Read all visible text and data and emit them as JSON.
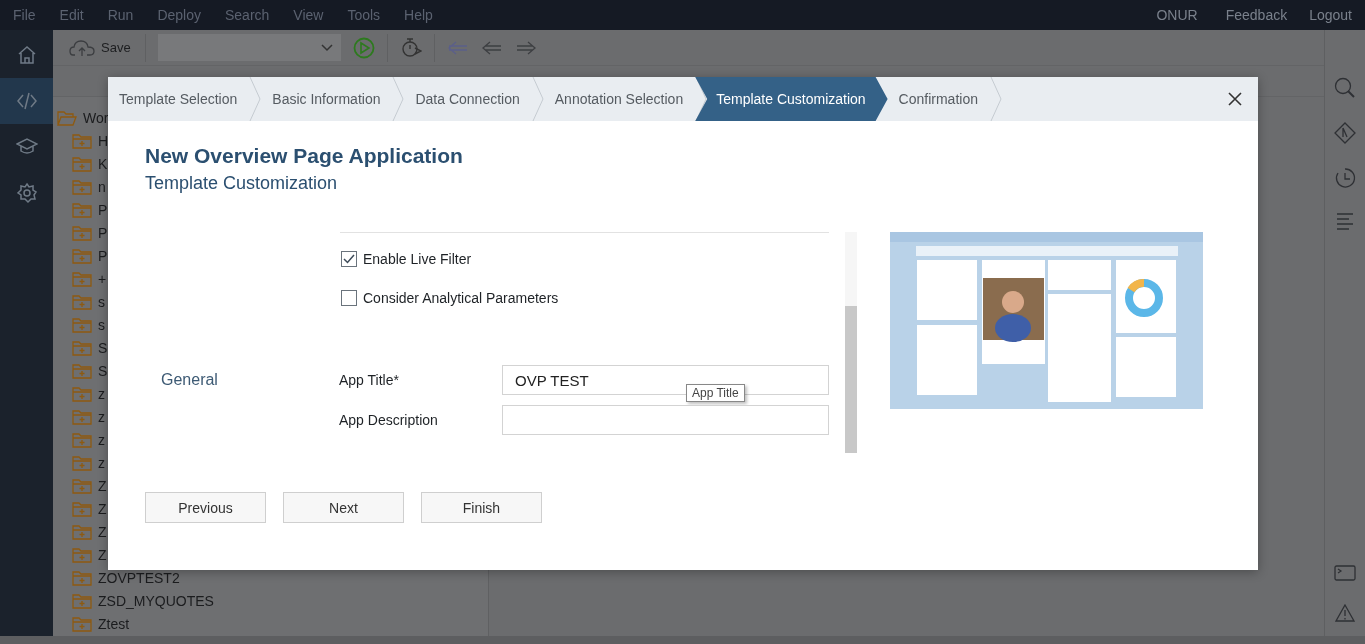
{
  "menu_bar": {
    "items": [
      "File",
      "Edit",
      "Run",
      "Deploy",
      "Search",
      "View",
      "Tools",
      "Help"
    ],
    "user": "ONUR",
    "links": [
      "Feedback",
      "Logout"
    ]
  },
  "rail": {
    "items": [
      {
        "kind": "home",
        "selected": false
      },
      {
        "kind": "code",
        "selected": true
      },
      {
        "kind": "learn",
        "selected": false
      },
      {
        "kind": "settings",
        "selected": false
      }
    ]
  },
  "toolbar": {
    "save": "Save"
  },
  "tree": {
    "root": "Wor",
    "children": [
      "H",
      "K",
      "n",
      "P",
      "P",
      "P",
      "+",
      "s",
      "s",
      "S",
      "S",
      "z",
      "z",
      "z",
      "z",
      "Z",
      "Z",
      "Z",
      "Z",
      "ZOVPTEST2",
      "ZSD_MYQUOTES",
      "Ztest"
    ]
  },
  "dialog": {
    "steps": [
      {
        "label": "Template Selection",
        "selected": false
      },
      {
        "label": "Basic Information",
        "selected": false
      },
      {
        "label": "Data Connection",
        "selected": false
      },
      {
        "label": "Annotation Selection",
        "selected": false
      },
      {
        "label": "Template Customization",
        "selected": true
      },
      {
        "label": "Confirmation",
        "selected": false
      }
    ],
    "title": "New Overview Page Application",
    "subtitle": "Template Customization",
    "options": [
      {
        "label": "Enable Live Filter",
        "checked": true
      },
      {
        "label": "Consider Analytical Parameters",
        "checked": false
      }
    ],
    "section": "General",
    "fields": [
      {
        "label": "App Title*",
        "value": "OVP TEST"
      },
      {
        "label": "App Description"
      }
    ],
    "tooltip": "App Title",
    "preview": {
      "kind": "picture"
    },
    "buttons": [
      "Previous",
      "Next",
      "Finish"
    ]
  }
}
